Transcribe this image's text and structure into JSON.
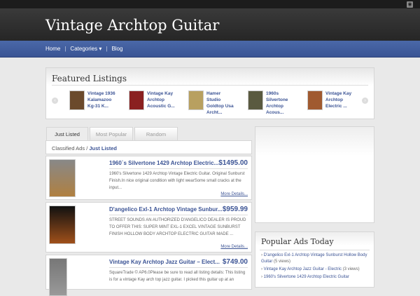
{
  "header": {
    "title": "Vintage Archtop Guitar",
    "rss_icon": "rss-icon"
  },
  "nav": {
    "items": [
      "Home",
      "Categories",
      "Blog"
    ],
    "caret": "▾"
  },
  "featured": {
    "title": "Featured Listings",
    "items": [
      "Vintage 1936 Kalamazoo Kg-31 K...",
      "Vintage Kay Archtop Acoustic G...",
      "Hamer Studio Goldtop Usa Archt...",
      "1960s Silvertone Archtop Acous...",
      "Vintage  Kay Archtop Electric ..."
    ],
    "prev": "‹",
    "next": "›"
  },
  "tabs": [
    "Just Listed",
    "Most Popular",
    "Random"
  ],
  "breadcrumb": {
    "root": "Classified Ads /",
    "current": "Just Listed"
  },
  "listings": [
    {
      "title": "1960`s Silvertone 1429 Archtop Electric...",
      "price": "$1495.00",
      "desc": "1960's Silvertone 1429 Archtop Vintage Electric Guitar. Original Sunburst Finish.In nice original condition with light wearSome small cracks at the input...",
      "more": "More Details..."
    },
    {
      "title": "D'angelico Exl-1 Archtop Vintage Sunbur...",
      "price": "$959.99",
      "desc": "STREET SOUNDS AN AUTHORIZED D'ANGELICO DEALER IS PROUD TO OFFER THIS: SUPER MINT EXL-1 EXCEL VINTAGE SUNBURST FINISH HOLLOW BODY ARCHTOP ELECTRIC GUITAR MADE ...",
      "more": "More Details..."
    },
    {
      "title": "Vintage Kay Archtop Jazz Guitar – Elect...",
      "price": "$749.00",
      "desc": "SquareTrade © AP6.0Please be sure to read all listing details:  This listing is for a vintage Kay arch top jazz guitar.  I picked this guitar up at an"
    }
  ],
  "popular": {
    "title": "Popular Ads Today",
    "items": [
      {
        "link": "D'angelico Exl-1 Archtop Vintage Sunburst Hollow Body Guitar",
        "views": "(5 views)"
      },
      {
        "link": "Vintage Kay Archtop Jazz Guitar - Electric",
        "views": "(3 views)"
      },
      {
        "link": "1960's Silvertone 1429 Archtop Electric Guitar",
        "views": ""
      }
    ]
  }
}
